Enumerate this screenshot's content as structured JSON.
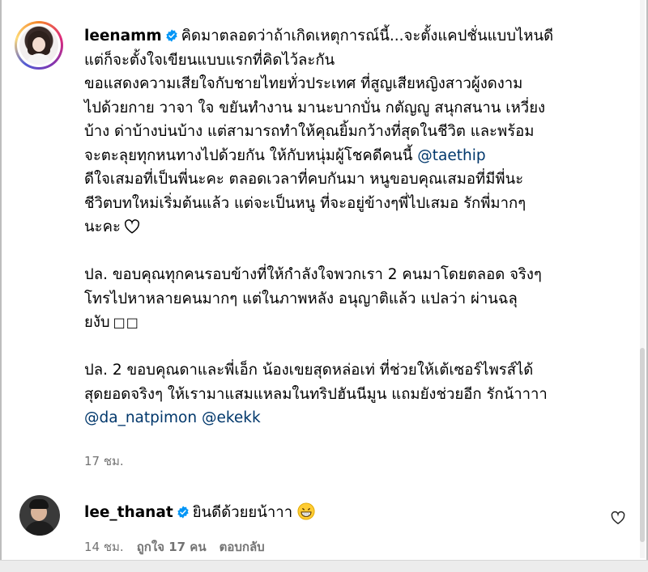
{
  "post": {
    "username": "leenamm",
    "lines": [
      "คิดมาตลอดว่าถ้าเกิดเหตุการณ์นี้...จะตั้งแคปชั่นแบบไหนดี",
      "แต่ก็จะตั้งใจเขียนแบบแรกที่คิดไว้ละกัน"
    ],
    "para1": [
      "ขอแสดงความเสียใจกับชายไทยทั่วประเทศ ที่สูญเสียหญิงสาวผู้งดงาม",
      "ไปด้วยกาย วาจา ใจ ขยันทำงาน มานะบากบั่น กตัญญู สนุกสนาน เหวี่ยง",
      "บ้าง ด่าบ้างบ่นบ้าง แต่สามารถทำให้คุณยิ้มกว้างที่สุดในชีวิต และพร้อม"
    ],
    "para1_line4_text": "จะตะลุยทุกหนทางไปด้วยกัน ให้กับหนุ่มผู้โชคดีคนนี้",
    "para1_mention": "@taethip",
    "para1_tail": [
      "ดีใจเสมอที่เป็นพี่นะคะ ตลอดเวลาที่คบกันมา หนูขอบคุณเสมอที่มีพี่นะ",
      "ชีวิตบทใหม่เริ่มต้นแล้ว แต่จะเป็นหนู ที่จะอยู่ข้างๆพี่ไปเสมอ รักพี่มากๆ"
    ],
    "para1_last": "นะคะ",
    "ps1": [
      "ปล. ขอบคุณทุกคนรอบข้างที่ให้กำลังใจพวกเรา 2 คนมาโดยตลอด จริงๆ",
      "โทรไปหาหลายคนมากๆ แต่ในภาพหลัง อนุญาติแล้ว แปลว่า ผ่านฉลุ"
    ],
    "ps1_last": "ยงับ",
    "ps1_boxes": "□□",
    "ps2": [
      "ปล. 2 ขอบคุณดาและพี่เอ็ก น้องเขยสุดหล่อเท่ ที่ช่วยให้เต้เซอร์ไพรส์ได้",
      "สุดยอดจริงๆ ให้เรามาแสมแหลมในทริปฮันนีมูน แถมยังช่วยอีก รักน้าาาา"
    ],
    "ps2_mentions": [
      "@da_natpimon",
      "@ekekk"
    ],
    "time": "17 ชม."
  },
  "reply": {
    "username": "lee_thanat",
    "text": "ยินดีด้วยยน้าาา",
    "time": "14 ชม.",
    "likes": "ถูกใจ 17 คน",
    "reply_label": "ตอบกลับ"
  },
  "icons": {
    "verified": "verified-badge-icon",
    "heart": "heart-outline-icon",
    "emoji": "grinning-face-icon",
    "like": "heart-like-icon"
  },
  "colors": {
    "verified": "#0095f6",
    "mention": "#00376b",
    "meta": "#737373"
  }
}
